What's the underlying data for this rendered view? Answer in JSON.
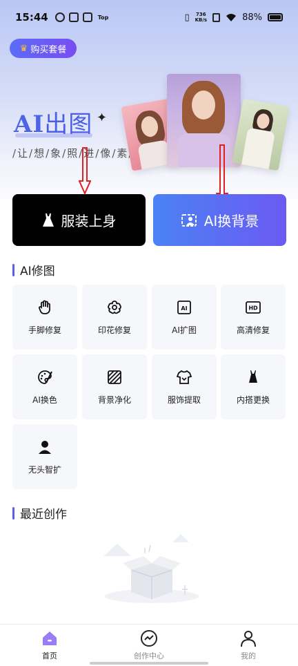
{
  "status_bar": {
    "time": "15:44",
    "top_label": "Top",
    "net_speed_value": "736",
    "net_speed_unit": "KB/s",
    "battery": "88%"
  },
  "header": {
    "buy_label": "购买套餐"
  },
  "hero": {
    "title_ai": "AI",
    "title_cn": "出图",
    "subtitle": "/让/想/象/照/进/像/素/"
  },
  "actions": {
    "dress_label": "服装上身",
    "bg_label": "AI换背景"
  },
  "ai_repair": {
    "title": "AI修图",
    "tools": [
      {
        "label": "手脚修复",
        "icon": "hand-icon"
      },
      {
        "label": "印花修复",
        "icon": "flower-icon"
      },
      {
        "label": "AI扩图",
        "icon": "ai-expand-icon"
      },
      {
        "label": "高清修复",
        "icon": "hd-icon"
      },
      {
        "label": "AI换色",
        "icon": "palette-icon"
      },
      {
        "label": "背景净化",
        "icon": "stripes-icon"
      },
      {
        "label": "服饰提取",
        "icon": "shirt-icon"
      },
      {
        "label": "内搭更换",
        "icon": "camisole-icon"
      },
      {
        "label": "无头智扩",
        "icon": "person-icon"
      }
    ]
  },
  "recent": {
    "title": "最近创作"
  },
  "tab_bar": {
    "tabs": [
      {
        "label": "首页",
        "icon": "home-icon",
        "active": true
      },
      {
        "label": "创作中心",
        "icon": "trend-icon",
        "active": false
      },
      {
        "label": "我的",
        "icon": "profile-icon",
        "active": false
      }
    ]
  },
  "colors": {
    "accent": "#5b5cf0",
    "annotation_arrow": "#e02020"
  }
}
